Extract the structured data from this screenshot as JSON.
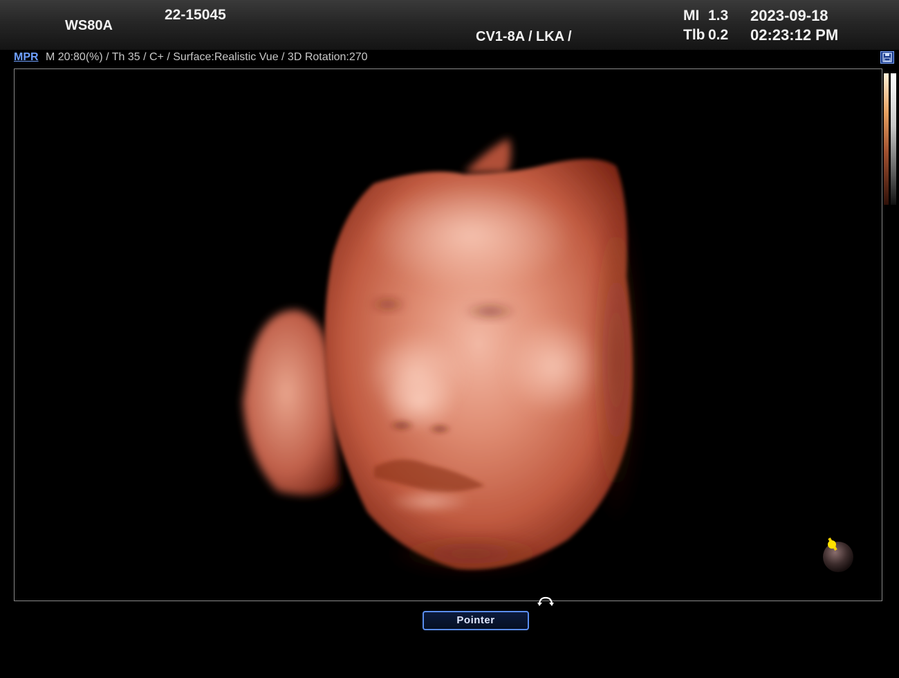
{
  "header": {
    "system": "WS80A",
    "patient_id": "22-15045",
    "probe": "CV1-8A / LKA /",
    "mi_label": "MI",
    "mi_value": "1.3",
    "tib_label": "Tlb",
    "tib_value": "0.2",
    "date": "2023-09-18",
    "time": "02:23:12 PM"
  },
  "info": {
    "mode": "MPR",
    "params": "M 20:80(%) / Th 35 / C+ / Surface:Realistic Vue / 3D Rotation:270"
  },
  "icons": {
    "save": "save-icon",
    "rotate": "rotate-arrow-icon",
    "orientation": "orientation-marker-icon"
  },
  "colors": {
    "accent": "#5a8ef0",
    "mode_link": "#6fa0ff",
    "marker": "#ffd400",
    "skin": "#c86048"
  },
  "controls": {
    "pointer_label": "Pointer"
  }
}
